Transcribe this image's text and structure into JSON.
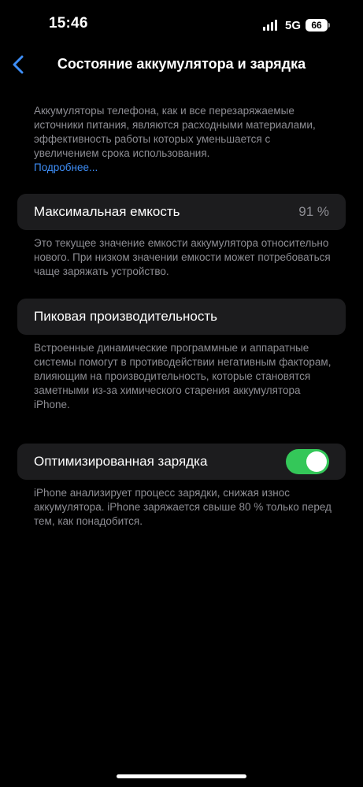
{
  "status_bar": {
    "time": "15:46",
    "network": "5G",
    "battery_level": "66"
  },
  "nav": {
    "title": "Состояние аккумулятора и зарядка"
  },
  "intro": {
    "text": "Аккумуляторы телефона, как и все перезаряжаемые источники питания, являются расходными материалами, эффективность работы которых уменьшается с увеличением срока использования.",
    "link": "Подробнее..."
  },
  "max_capacity": {
    "label": "Максимальная емкость",
    "value": "91 %",
    "footnote": "Это текущее значение емкости аккумулятора относительно нового. При низком значении емкости может потребоваться чаще заряжать устройство."
  },
  "peak_performance": {
    "label": "Пиковая производительность",
    "footnote": "Встроенные динамические программные и аппаратные системы помогут в противодействии негативным факторам, влияющим на производительность, которые становятся заметными из-за химического старения аккумулятора iPhone."
  },
  "optimized_charging": {
    "label": "Оптимизированная зарядка",
    "enabled": true,
    "footnote": "iPhone анализирует процесс зарядки, снижая износ аккумулятора. iPhone заряжается свыше 80 % только перед тем, как понадобится."
  },
  "colors": {
    "background": "#000000",
    "cell": "#1c1c1e",
    "secondary_text": "#8d8d93",
    "link": "#3e8ef7",
    "toggle_on": "#34c759"
  },
  "icons": {
    "back": "chevron-left-icon",
    "signal": "cellular-signal-icon",
    "battery": "battery-icon"
  }
}
